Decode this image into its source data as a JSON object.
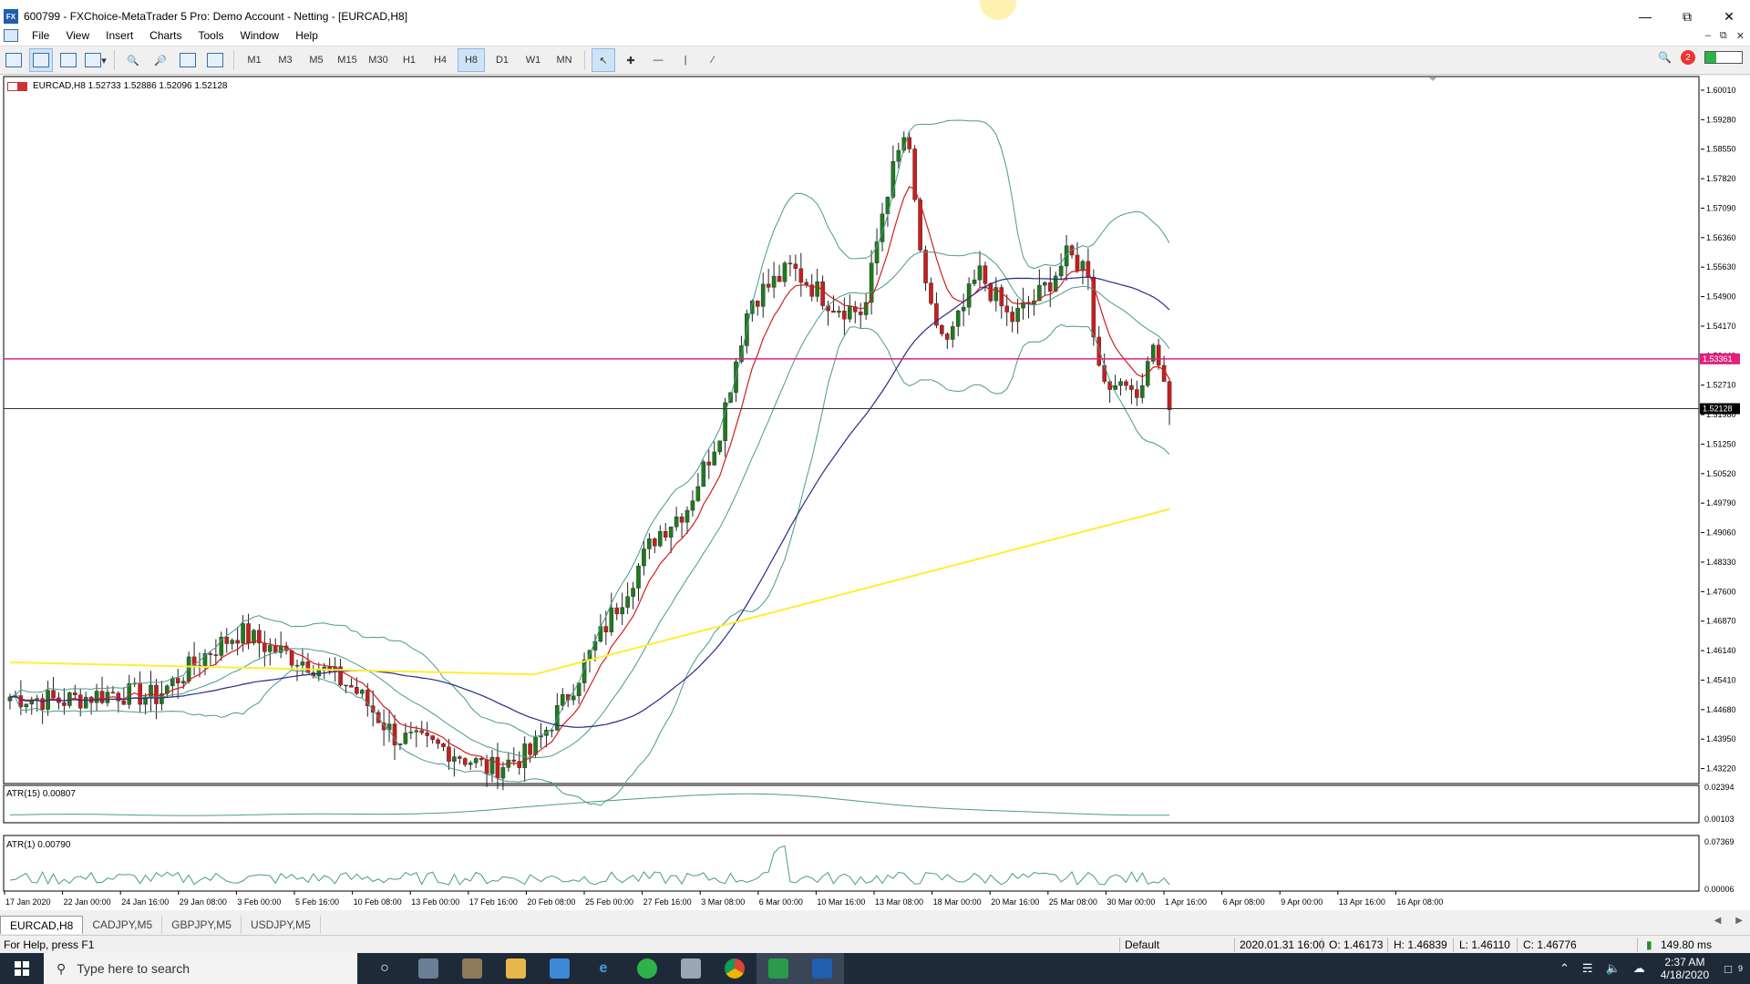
{
  "window": {
    "title": "600799 - FXChoice-MetaTrader 5 Pro: Demo Account - Netting - [EURCAD,H8]",
    "app_icon": "FX"
  },
  "menu": {
    "items": [
      "File",
      "View",
      "Insert",
      "Charts",
      "Tools",
      "Window",
      "Help"
    ]
  },
  "toolbar": {
    "timeframes": [
      "M1",
      "M3",
      "M5",
      "M15",
      "M30",
      "H1",
      "H4",
      "H8",
      "D1",
      "W1",
      "MN"
    ],
    "active_timeframe": "H8",
    "notification_count": "2"
  },
  "chart": {
    "symbol_label": "EURCAD,H8  1.52733 1.52886 1.52096 1.52128",
    "price_axis": [
      "1.60010",
      "1.59280",
      "1.58550",
      "1.57820",
      "1.57090",
      "1.56360",
      "1.55630",
      "1.54900",
      "1.54170",
      "1.53440",
      "1.52710",
      "1.51980",
      "1.51250",
      "1.50520",
      "1.49790",
      "1.49060",
      "1.48330",
      "1.47600",
      "1.46870",
      "1.46140",
      "1.45410",
      "1.44680",
      "1.43950",
      "1.43220"
    ],
    "magenta_level": "1.53361",
    "bid_level": "1.52128",
    "time_axis": [
      "17 Jan 2020",
      "22 Jan 00:00",
      "24 Jan 16:00",
      "29 Jan 08:00",
      "3 Feb 00:00",
      "5 Feb 16:00",
      "10 Feb 08:00",
      "13 Feb 00:00",
      "17 Feb 16:00",
      "20 Feb 08:00",
      "25 Feb 00:00",
      "27 Feb 16:00",
      "3 Mar 08:00",
      "6 Mar 00:00",
      "10 Mar 16:00",
      "13 Mar 08:00",
      "18 Mar 00:00",
      "20 Mar 16:00",
      "25 Mar 08:00",
      "30 Mar 00:00",
      "1 Apr 16:00",
      "6 Apr 08:00",
      "9 Apr 00:00",
      "13 Apr 16:00",
      "16 Apr 08:00"
    ],
    "colors": {
      "bull": "#1e7b1e",
      "bear": "#c81e1e",
      "ema_fast": "#d02020",
      "ma_slow": "#2a2a8a",
      "ma_long": "#ffee33",
      "bands": "#4a9a8a",
      "level": "#e0217f"
    }
  },
  "atr1": {
    "label": "ATR(15) 0.00807",
    "axis_top": "0.02394",
    "axis_bottom": "0.00103"
  },
  "atr2": {
    "label": "ATR(1) 0.00790",
    "axis_top": "0.07369",
    "axis_bottom": "0.00006"
  },
  "tabs": [
    "EURCAD,H8",
    "CADJPY,M5",
    "GBPJPY,M5",
    "USDJPY,M5"
  ],
  "status": {
    "help": "For Help, press F1",
    "profile": "Default",
    "datetime": "2020.01.31 16:00",
    "open": "O: 1.46173",
    "high": "H: 1.46839",
    "low": "L: 1.46110",
    "close": "C: 1.46776",
    "ping": "149.80 ms"
  },
  "taskbar": {
    "search_placeholder": "Type here to search",
    "time": "2:37 AM",
    "date": "4/18/2020",
    "notif": "9"
  }
}
